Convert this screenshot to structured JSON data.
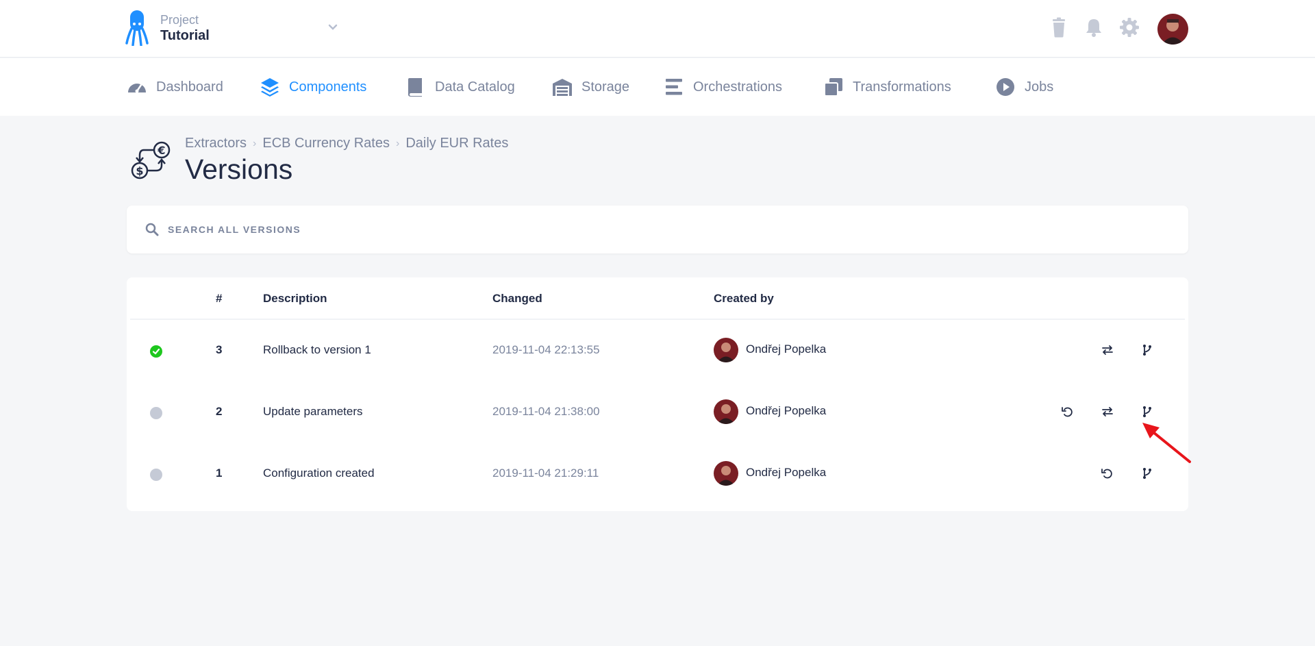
{
  "project": {
    "label": "Project",
    "name": "Tutorial"
  },
  "nav": {
    "dashboard": "Dashboard",
    "components": "Components",
    "data_catalog": "Data Catalog",
    "storage": "Storage",
    "orchestrations": "Orchestrations",
    "transformations": "Transformations",
    "jobs": "Jobs"
  },
  "breadcrumb": [
    "Extractors",
    "ECB Currency Rates",
    "Daily EUR Rates"
  ],
  "page_title": "Versions",
  "search": {
    "placeholder": "SEARCH ALL VERSIONS"
  },
  "table": {
    "headers": {
      "number": "#",
      "description": "Description",
      "changed": "Changed",
      "created_by": "Created by"
    },
    "rows": [
      {
        "number": "3",
        "description": "Rollback to version 1",
        "changed": "2019-11-04 22:13:55",
        "created_by": "Ondřej Popelka",
        "status": "active",
        "actions": [
          "compare",
          "fork"
        ]
      },
      {
        "number": "2",
        "description": "Update parameters",
        "changed": "2019-11-04 21:38:00",
        "created_by": "Ondřej Popelka",
        "status": "inactive",
        "actions": [
          "rollback",
          "compare",
          "fork"
        ]
      },
      {
        "number": "1",
        "description": "Configuration created",
        "changed": "2019-11-04 21:29:11",
        "created_by": "Ondřej Popelka",
        "status": "inactive",
        "actions": [
          "rollback",
          "fork"
        ]
      }
    ]
  },
  "colors": {
    "accent": "#1f8fff",
    "active_status": "#1ec71e",
    "inactive_status": "#c5cad6",
    "annotation_arrow": "#e8151b"
  }
}
